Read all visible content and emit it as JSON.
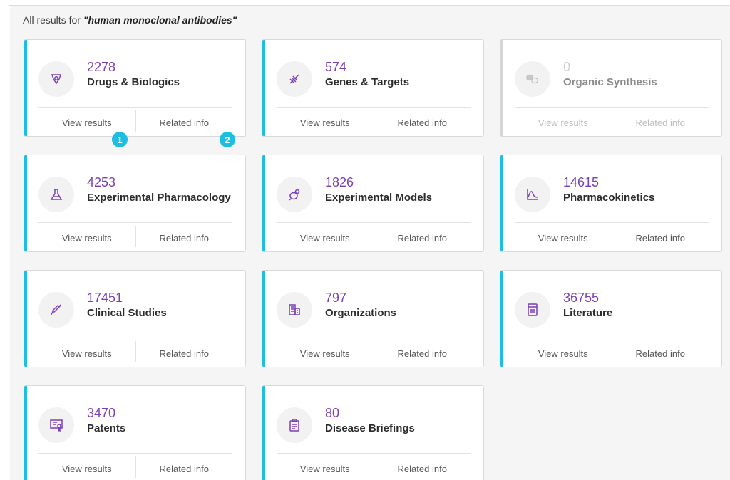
{
  "header": {
    "prefix": "All results for ",
    "query": "\"human monoclonal antibodies\""
  },
  "actions": {
    "view": "View results",
    "related": "Related info"
  },
  "cards": [
    {
      "count": "2278",
      "label": "Drugs & Biologics",
      "icon": "drug-capsule-icon"
    },
    {
      "count": "574",
      "label": "Genes & Targets",
      "icon": "dna-icon"
    },
    {
      "count": "0",
      "label": "Organic Synthesis",
      "icon": "molecule-icon"
    },
    {
      "count": "4253",
      "label": "Experimental Pharmacology",
      "icon": "flask-icon"
    },
    {
      "count": "1826",
      "label": "Experimental Models",
      "icon": "mouse-icon"
    },
    {
      "count": "14615",
      "label": "Pharmacokinetics",
      "icon": "chart-curve-icon"
    },
    {
      "count": "17451",
      "label": "Clinical Studies",
      "icon": "syringe-icon"
    },
    {
      "count": "797",
      "label": "Organizations",
      "icon": "building-icon"
    },
    {
      "count": "36755",
      "label": "Literature",
      "icon": "document-icon"
    },
    {
      "count": "3470",
      "label": "Patents",
      "icon": "certificate-icon"
    },
    {
      "count": "80",
      "label": "Disease Briefings",
      "icon": "clipboard-icon"
    }
  ],
  "badges": [
    "1",
    "2"
  ],
  "colors": {
    "accent": "#1ebee1",
    "count": "#7b3fb3",
    "disabled_bar": "#d6d6d6"
  }
}
